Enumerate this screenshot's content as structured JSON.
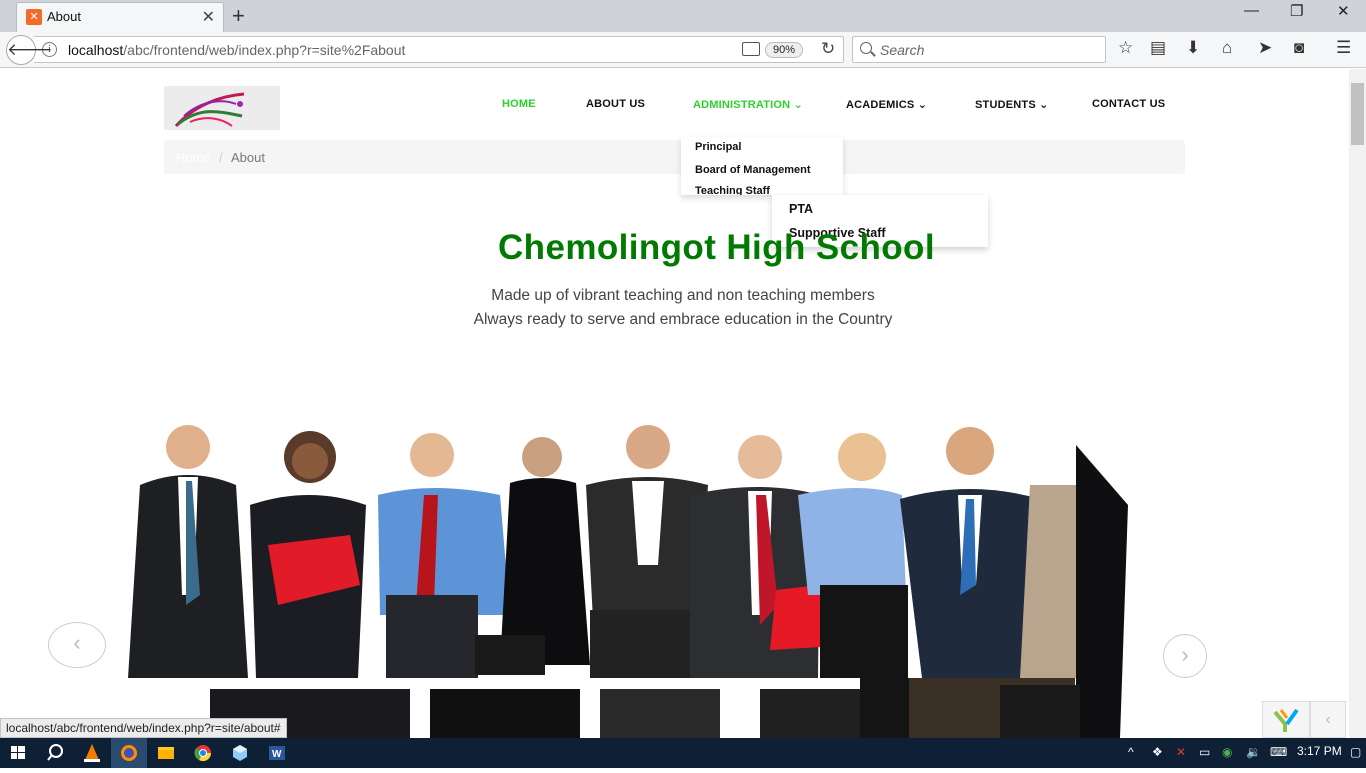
{
  "browser": {
    "tab_title": "About",
    "tab_favicon": "xampp-favicon",
    "url_host": "localhost",
    "url_path": "/abc/frontend/web/index.php?r=site%2Fabout",
    "zoom": "90%",
    "search_placeholder": "Search",
    "status_url": "localhost/abc/frontend/web/index.php?r=site/about#"
  },
  "site": {
    "nav": {
      "home": "HOME",
      "about": "ABOUT US",
      "administration": "ADMINISTRATION",
      "academics": "ACADEMICS",
      "students": "STUDENTS",
      "contact": "CONTACT US"
    },
    "active_nav_color": "#2bd12b",
    "breadcrumb": {
      "home": "Home",
      "separator": "/",
      "current": "About"
    },
    "admin_dropdown": [
      "Principal",
      "Board of Management",
      "Teaching Staff"
    ],
    "admin_dropdown_overflow": [
      "PTA",
      "Supportive Staff"
    ],
    "heading": "Chemolingot High School",
    "heading_color": "#007a00",
    "subtitle_1": "Made up of vibrant teaching and non teaching members",
    "subtitle_2": "Always ready to serve and embrace education in the Country"
  },
  "taskbar": {
    "time": "3:17 PM",
    "apps": [
      "start-icon",
      "search-icon",
      "vlc-icon",
      "firefox-icon",
      "file-explorer-icon",
      "chrome-icon",
      "virtualbox-icon",
      "word-icon"
    ]
  }
}
